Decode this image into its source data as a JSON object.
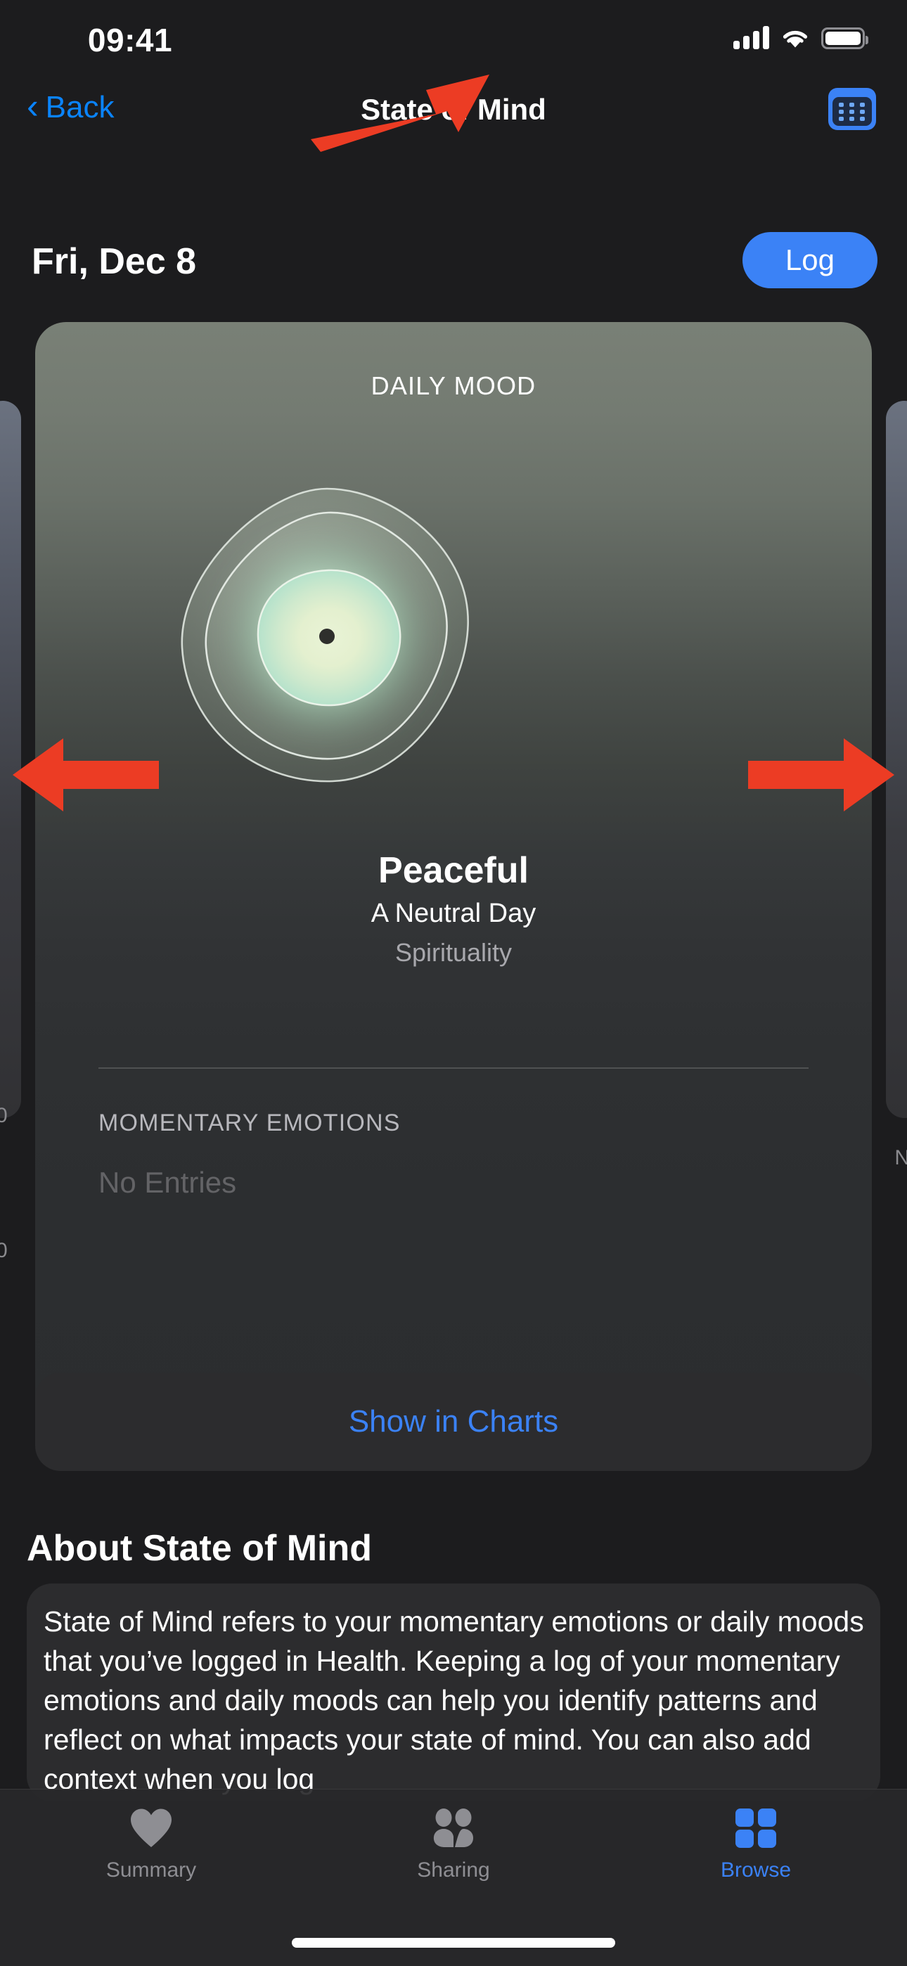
{
  "status_bar": {
    "time": "09:41",
    "cellular_icon": "cellular-signal-icon",
    "wifi_icon": "wifi-icon",
    "battery_icon": "battery-icon"
  },
  "nav_bar": {
    "back_label": "Back",
    "back_icon": "chevron-left-icon",
    "title": "State of Mind",
    "calendar_icon": "calendar-icon"
  },
  "date_row": {
    "date": "Fri, Dec 8",
    "log_label": "Log"
  },
  "mood_card": {
    "header": "DAILY MOOD",
    "mood_name": "Peaceful",
    "mood_valence": "A Neutral Day",
    "association": "Spirituality",
    "section_title": "MOMENTARY EMOTIONS",
    "section_empty": "No Entries"
  },
  "show_in_charts": {
    "label": "Show in Charts"
  },
  "about": {
    "heading": "About State of Mind",
    "body": "State of Mind refers to your momentary emotions or daily moods that you’ve logged in Health. Keeping a log of your momentary emotions and daily moods can help you identify patterns and reflect on what impacts your state of mind. You can also add context when you log"
  },
  "tab_bar": {
    "tabs": [
      {
        "label": "Summary",
        "icon": "heart-icon",
        "active": false
      },
      {
        "label": "Sharing",
        "icon": "people-icon",
        "active": false
      },
      {
        "label": "Browse",
        "icon": "grid-icon",
        "active": true
      }
    ]
  },
  "annotations": {
    "color": "#ec3c24",
    "arrows": [
      {
        "name": "arrow-to-calendar-button",
        "direction": "up-right"
      },
      {
        "name": "arrow-swipe-left",
        "direction": "left"
      },
      {
        "name": "arrow-swipe-right",
        "direction": "right"
      }
    ]
  },
  "colors": {
    "accent_blue": "#3b82f6",
    "link_blue": "#0a84ff",
    "background": "#1c1c1e",
    "card_surface": "#2c2c2e",
    "annotation_red": "#ec3c24",
    "mood_green": "#a8d9b4"
  }
}
